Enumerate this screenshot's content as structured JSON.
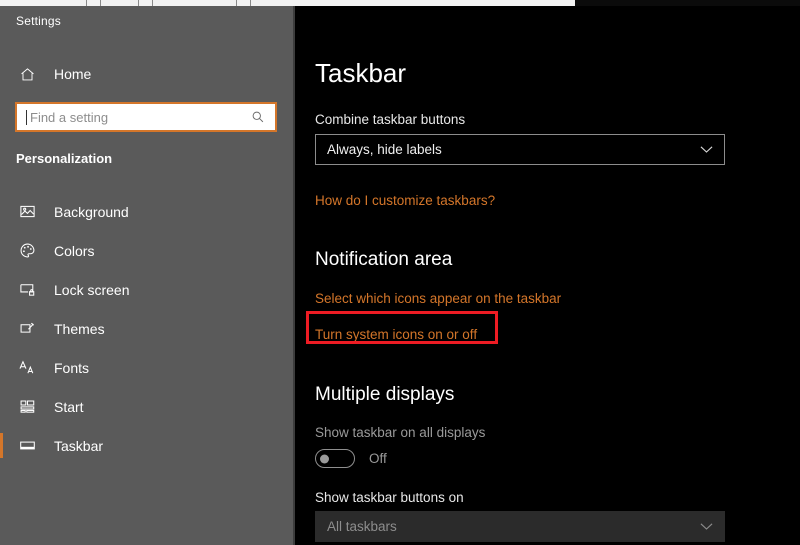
{
  "window": {
    "title": "Settings",
    "controls": [
      {
        "name": "minimize",
        "glyph": "minimize-icon"
      },
      {
        "name": "maximize",
        "glyph": "maximize-icon"
      },
      {
        "name": "close",
        "glyph": "close-icon"
      }
    ]
  },
  "sidebar": {
    "home_label": "Home",
    "home_icon": "home-icon",
    "search": {
      "placeholder": "Find a setting",
      "value": "",
      "icon": "search-icon"
    },
    "category": "Personalization",
    "items": [
      {
        "label": "Background",
        "icon": "image-icon",
        "selected": false
      },
      {
        "label": "Colors",
        "icon": "palette-icon",
        "selected": false
      },
      {
        "label": "Lock screen",
        "icon": "lockscreen-icon",
        "selected": false
      },
      {
        "label": "Themes",
        "icon": "themes-icon",
        "selected": false
      },
      {
        "label": "Fonts",
        "icon": "fonts-icon",
        "selected": false
      },
      {
        "label": "Start",
        "icon": "start-icon",
        "selected": false
      },
      {
        "label": "Taskbar",
        "icon": "taskbar-icon",
        "selected": true
      }
    ]
  },
  "main": {
    "page_title": "Taskbar",
    "combine_label": "Combine taskbar buttons",
    "combine_value": "Always, hide labels",
    "customize_link": "How do I customize taskbars?",
    "notification_heading": "Notification area",
    "select_icons_link": "Select which icons appear on the taskbar",
    "system_icons_link": "Turn system icons on or off",
    "multiple_displays_heading": "Multiple displays",
    "show_all_displays_label": "Show taskbar on all displays",
    "show_all_displays_state": "Off",
    "show_buttons_label": "Show taskbar buttons on",
    "show_buttons_value": "All taskbars"
  },
  "colors": {
    "accent": "#d4762a",
    "highlight": "#ee1c24",
    "sidebar_bg": "#5a5a5a",
    "content_bg": "#000000"
  }
}
